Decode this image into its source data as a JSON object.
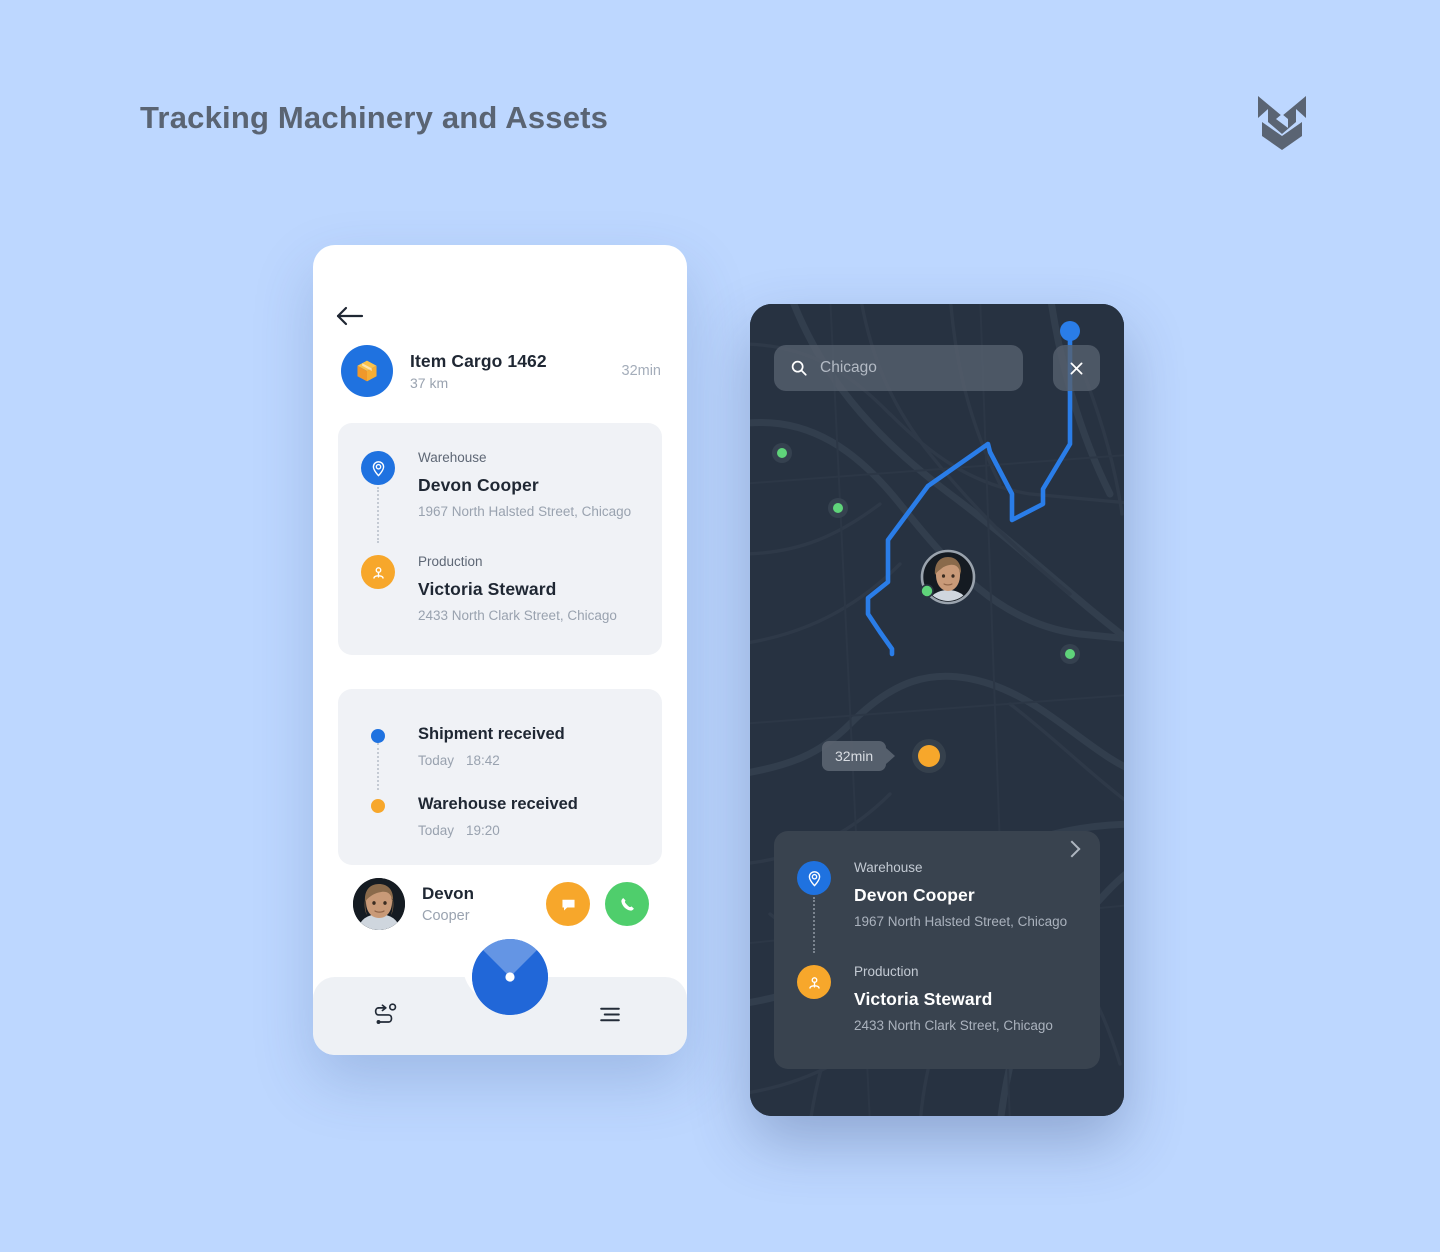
{
  "page": {
    "title": "Tracking Machinery and Assets",
    "logo_name": "ms-monogram-logo",
    "background_color": "#bdd7ff",
    "accent_blue": "#1f72e0",
    "accent_orange": "#f7a72b",
    "accent_green": "#4fce6c"
  },
  "left_phone": {
    "back_icon": "back-arrow-icon",
    "cargo": {
      "icon": "cargo-box-icon",
      "title": "Item Cargo 1462",
      "distance": "37 km",
      "eta": "32min"
    },
    "stops": [
      {
        "icon": "map-pin-icon",
        "kind": "Warehouse",
        "name": "Devon Cooper",
        "address": "1967 North Halsted Street, Chicago",
        "color": "#1f72e0"
      },
      {
        "icon": "person-pin-icon",
        "kind": "Production",
        "name": "Victoria Steward",
        "address": "2433 North Clark Street, Chicago",
        "color": "#f7a72b"
      }
    ],
    "timeline": [
      {
        "title": "Shipment received",
        "day": "Today",
        "time": "18:42",
        "color": "#1f72e0"
      },
      {
        "title": "Warehouse received",
        "day": "Today",
        "time": "19:20",
        "color": "#f7a72b"
      }
    ],
    "contact": {
      "avatar": "driver-avatar",
      "first_name": "Devon",
      "last_name": "Cooper",
      "chat_icon": "chat-bubble-icon",
      "call_icon": "phone-icon"
    },
    "tabbar": {
      "route_icon": "route-icon",
      "navigate_icon": "navigation-radar-icon",
      "menu_icon": "menu-lines-icon"
    }
  },
  "right_phone": {
    "search": {
      "icon": "search-icon",
      "value": "Chicago",
      "placeholder": "Chicago",
      "close_icon": "close-icon"
    },
    "map": {
      "eta_chip": "32min",
      "start_marker": "route-start-dot",
      "end_marker": "route-end-dot",
      "driver_marker": "driver-map-avatar",
      "poi_count": 4
    },
    "stops": [
      {
        "icon": "map-pin-icon",
        "kind": "Warehouse",
        "name": "Devon Cooper",
        "address": "1967 North Halsted Street, Chicago",
        "color": "#1f72e0"
      },
      {
        "icon": "person-pin-icon",
        "kind": "Production",
        "name": "Victoria Steward",
        "address": "2433 North Clark Street, Chicago",
        "color": "#f7a72b"
      }
    ],
    "chevron_icon": "chevron-right-icon"
  }
}
